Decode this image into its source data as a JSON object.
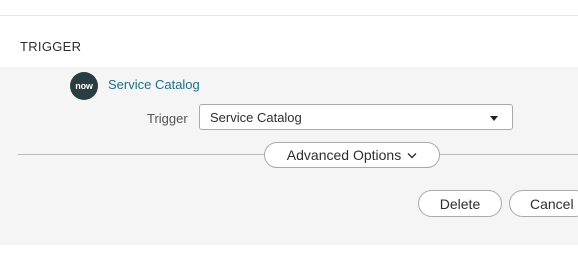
{
  "section": {
    "title": "TRIGGER"
  },
  "spoke": {
    "logo_text": "now",
    "name": "Service Catalog"
  },
  "trigger": {
    "label": "Trigger",
    "selected_value": "Service Catalog"
  },
  "advanced_options": {
    "label": "Advanced Options"
  },
  "actions": {
    "delete_label": "Delete",
    "cancel_label": "Cancel"
  },
  "colors": {
    "accent_link": "#1f6e8a",
    "logo_bg": "#293e40",
    "panel_bg": "#f5f5f5"
  }
}
